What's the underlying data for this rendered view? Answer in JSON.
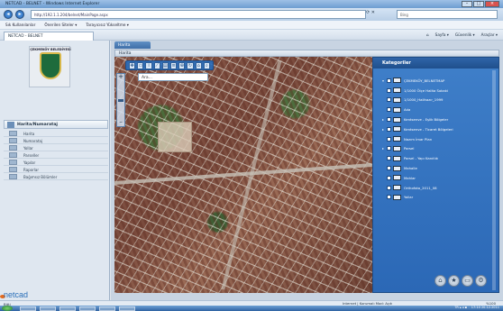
{
  "browser": {
    "title": "NETCAD - BELNET - Windows Internet Explorer",
    "address": "http://192.1.1.204/belnet/MainPage.aspx",
    "search_placeholder": "Bing",
    "favorites": [
      "Sık Kullanılanlar",
      "Önerilen Siteler ▾",
      "Tarayıcısız Yükseltme ▾"
    ],
    "tab_label": "NETCAD - BELNET",
    "commands": [
      "Sayfa ▾",
      "Güvenlik ▾",
      "Araçlar ▾"
    ],
    "window_buttons": [
      "–",
      "□",
      "×"
    ]
  },
  "left_panel": {
    "logo_text": "ÇEKMEKÖY BELEDİYESİ",
    "nav_header": "Harita/Numarataj",
    "nav_items": [
      "Harita",
      "Numarataj",
      "Yollar",
      "Parseller",
      "Yapılar",
      "Raporlar",
      "Bağımsız Bölümler"
    ],
    "brand": "netcad"
  },
  "main": {
    "tab": "Harita",
    "bar_title": "Harita",
    "map_search_value": "Ara...",
    "zoom_plus": "+",
    "zoom_minus": "–",
    "toolbar_icons": [
      "pan-icon",
      "select-icon",
      "info-icon",
      "measure-icon",
      "print-icon",
      "layers-icon",
      "zoom-icon",
      "refresh-icon",
      "home-icon",
      "search-icon",
      "close-icon"
    ]
  },
  "layers": {
    "title": "Kategoriler",
    "items": [
      {
        "label": "ÇEKMEKÖY_BELNETMAP",
        "expand": "▾"
      },
      {
        "label": "1/1000 Ölçe Halita Sokaki",
        "expand": ""
      },
      {
        "label": "1/1000_Halihazır_1999",
        "expand": ""
      },
      {
        "label": "Ada",
        "expand": ""
      },
      {
        "label": "Kentsenve - Eşlik Bölgeler",
        "expand": "▸"
      },
      {
        "label": "Kentsenve - Ticaret Bölgeleri",
        "expand": "▸"
      },
      {
        "label": "Nazım İmar Plan",
        "expand": ""
      },
      {
        "label": "Parsel",
        "expand": "▸"
      },
      {
        "label": "Parsel - Yapı Kanıtlık",
        "expand": ""
      },
      {
        "label": "Mahalle",
        "expand": ""
      },
      {
        "label": "Mahlar",
        "expand": ""
      },
      {
        "label": "Orthofoto_2011_08",
        "expand": ""
      },
      {
        "label": "Yollar",
        "expand": ""
      }
    ]
  },
  "status": {
    "left": "Bitti",
    "zone": "Internet | Korumalı Mod: Açık",
    "zoom": "%100"
  },
  "taskbar": {
    "clock": "17:10 20.12.2011",
    "tray": "TR ▴ ◂ ▪"
  }
}
